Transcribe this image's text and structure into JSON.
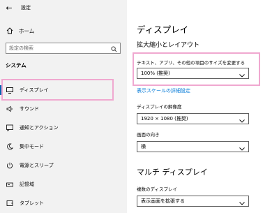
{
  "window": {
    "title": "設定",
    "back_symbol": "←"
  },
  "sidebar": {
    "home_label": "ホーム",
    "search_placeholder": "設定の検索",
    "section_title": "システム",
    "items": [
      {
        "label": "ディスプレイ",
        "icon": "monitor-icon",
        "active": true
      },
      {
        "label": "サウンド",
        "icon": "speaker-icon"
      },
      {
        "label": "通知とアクション",
        "icon": "notification-icon"
      },
      {
        "label": "集中モード",
        "icon": "moon-icon"
      },
      {
        "label": "電源とスリープ",
        "icon": "power-icon"
      },
      {
        "label": "記憶域",
        "icon": "storage-icon"
      },
      {
        "label": "タブレット",
        "icon": "tablet-icon"
      }
    ]
  },
  "main": {
    "title": "ディスプレイ",
    "scale_section": "拡大縮小とレイアウト",
    "scale_label": "テキスト、アプリ、その他の項目のサイズを変更する",
    "scale_value": "100% (推奨)",
    "advanced_link": "表示スケールの詳細設定",
    "resolution_label": "ディスプレイの解像度",
    "resolution_value": "1920 × 1080 (推奨)",
    "orientation_label": "画面の向き",
    "orientation_value": "横",
    "multi_title": "マルチ ディスプレイ",
    "multi_label": "複数のディスプレイ",
    "multi_value": "表示画面を拡張する"
  },
  "colors": {
    "accent": "#0063b1",
    "link": "#0078d7",
    "highlight": "#f0a8d0",
    "sidebar_bg": "#f2f2f2"
  }
}
